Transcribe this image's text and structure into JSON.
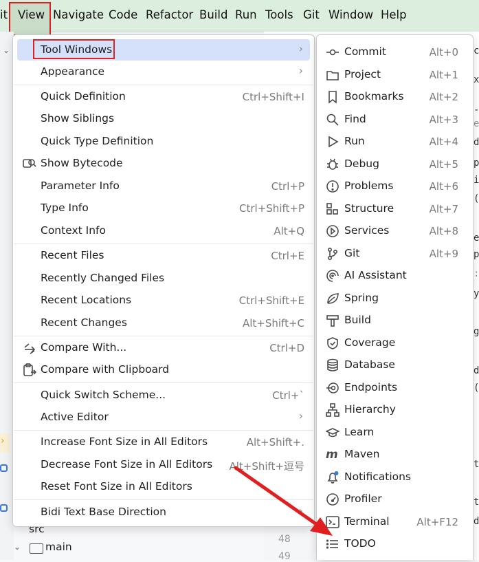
{
  "menubar": {
    "items": [
      "it",
      "View",
      "Navigate",
      "Code",
      "Refactor",
      "Build",
      "Run",
      "Tools",
      "Git",
      "Window",
      "Help"
    ]
  },
  "view_menu": {
    "items": [
      {
        "label": "Tool Windows",
        "shortcut": "",
        "submenu": true,
        "selected": true
      },
      {
        "label": "Appearance",
        "shortcut": "",
        "submenu": true
      },
      {
        "label": "Quick Definition",
        "shortcut": "Ctrl+Shift+I"
      },
      {
        "label": "Show Siblings",
        "shortcut": ""
      },
      {
        "label": "Quick Type Definition",
        "shortcut": ""
      },
      {
        "label": "Show Bytecode",
        "shortcut": "",
        "icon": "bytecode-search-icon"
      },
      {
        "label": "Parameter Info",
        "shortcut": "Ctrl+P"
      },
      {
        "label": "Type Info",
        "shortcut": "Ctrl+Shift+P"
      },
      {
        "label": "Context Info",
        "shortcut": "Alt+Q"
      },
      {
        "label": "Recent Files",
        "shortcut": "Ctrl+E"
      },
      {
        "label": "Recently Changed Files",
        "shortcut": ""
      },
      {
        "label": "Recent Locations",
        "shortcut": "Ctrl+Shift+E"
      },
      {
        "label": "Recent Changes",
        "shortcut": "Alt+Shift+C"
      },
      {
        "label": "Compare With...",
        "shortcut": "Ctrl+D",
        "icon": "compare-arrows-icon"
      },
      {
        "label": "Compare with Clipboard",
        "shortcut": "",
        "icon": "clipboard-icon"
      },
      {
        "label": "Quick Switch Scheme...",
        "shortcut": "Ctrl+`"
      },
      {
        "label": "Active Editor",
        "shortcut": "",
        "submenu": true
      },
      {
        "label": "Increase Font Size in All Editors",
        "shortcut": "Alt+Shift+."
      },
      {
        "label": "Decrease Font Size in All Editors",
        "shortcut": "Alt+Shift+逗号"
      },
      {
        "label": "Reset Font Size in All Editors",
        "shortcut": ""
      },
      {
        "label": "Bidi Text Base Direction",
        "shortcut": "",
        "submenu": true
      }
    ]
  },
  "tool_windows": {
    "items": [
      {
        "label": "Commit",
        "shortcut": "Alt+0",
        "icon": "commit-icon"
      },
      {
        "label": "Project",
        "shortcut": "Alt+1",
        "icon": "folder-icon"
      },
      {
        "label": "Bookmarks",
        "shortcut": "Alt+2",
        "icon": "bookmark-icon"
      },
      {
        "label": "Find",
        "shortcut": "Alt+3",
        "icon": "search-icon"
      },
      {
        "label": "Run",
        "shortcut": "Alt+4",
        "icon": "play-icon"
      },
      {
        "label": "Debug",
        "shortcut": "Alt+5",
        "icon": "bug-icon"
      },
      {
        "label": "Problems",
        "shortcut": "Alt+6",
        "icon": "warning-circle-icon"
      },
      {
        "label": "Structure",
        "shortcut": "Alt+7",
        "icon": "structure-icon"
      },
      {
        "label": "Services",
        "shortcut": "Alt+8",
        "icon": "services-icon"
      },
      {
        "label": "Git",
        "shortcut": "Alt+9",
        "icon": "git-branch-icon"
      },
      {
        "label": "AI Assistant",
        "shortcut": "",
        "icon": "ai-spiral-icon"
      },
      {
        "label": "Spring",
        "shortcut": "",
        "icon": "spring-leaf-icon"
      },
      {
        "label": "Build",
        "shortcut": "",
        "icon": "hammer-icon"
      },
      {
        "label": "Coverage",
        "shortcut": "",
        "icon": "shield-check-icon"
      },
      {
        "label": "Database",
        "shortcut": "",
        "icon": "database-icon"
      },
      {
        "label": "Endpoints",
        "shortcut": "",
        "icon": "endpoints-icon"
      },
      {
        "label": "Hierarchy",
        "shortcut": "",
        "icon": "hierarchy-icon"
      },
      {
        "label": "Learn",
        "shortcut": "",
        "icon": "graduation-cap-icon"
      },
      {
        "label": "Maven",
        "shortcut": "",
        "icon": "maven-icon"
      },
      {
        "label": "Notifications",
        "shortcut": "",
        "icon": "bell-icon"
      },
      {
        "label": "Profiler",
        "shortcut": "",
        "icon": "gauge-icon"
      },
      {
        "label": "Terminal",
        "shortcut": "Alt+F12",
        "icon": "terminal-icon"
      },
      {
        "label": "TODO",
        "shortcut": "",
        "icon": "list-icon"
      }
    ]
  },
  "project_tree": {
    "items": [
      {
        "label": "src"
      },
      {
        "label": "main"
      }
    ]
  },
  "editor": {
    "line_numbers": [
      "48",
      "49"
    ],
    "right_edge_chars": [
      "c",
      "x",
      "-",
      "e",
      "d",
      "p",
      "i",
      "(",
      "e",
      "p",
      ":",
      "y",
      "g",
      "d",
      "(",
      "t",
      "t",
      "d"
    ]
  },
  "colors": {
    "annotation": "#e02020",
    "menubar_bg": "#dcefdf",
    "selection": "#d5e1fb"
  }
}
